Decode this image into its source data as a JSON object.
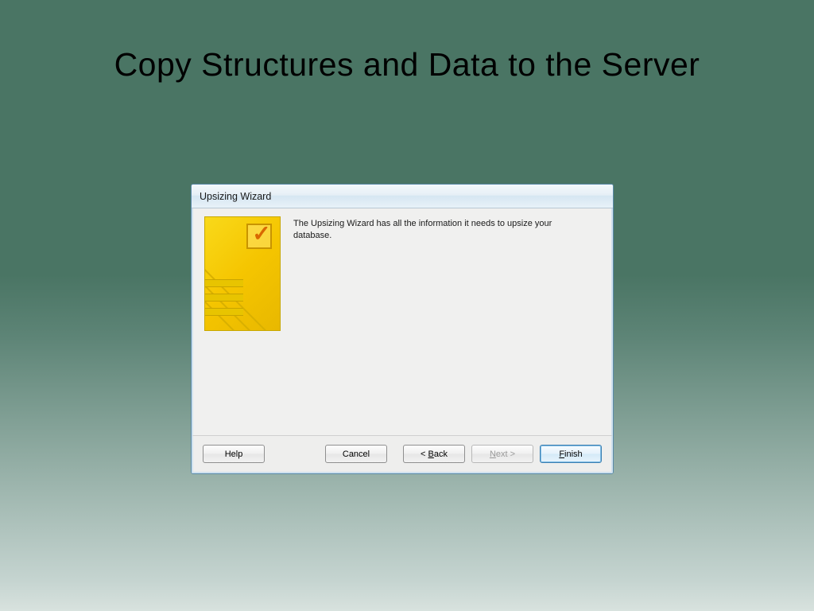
{
  "slide": {
    "title": "Copy Structures and Data to the Server"
  },
  "dialog": {
    "title": "Upsizing  Wizard",
    "body": "The Upsizing Wizard has all the information it needs to upsize your database.",
    "buttons": {
      "help": "Help",
      "cancel": "Cancel",
      "back_prefix": "< ",
      "back_letter": "B",
      "back_rest": "ack",
      "next_letter": "N",
      "next_rest": "ext >",
      "finish_letter": "F",
      "finish_rest": "inish"
    }
  }
}
